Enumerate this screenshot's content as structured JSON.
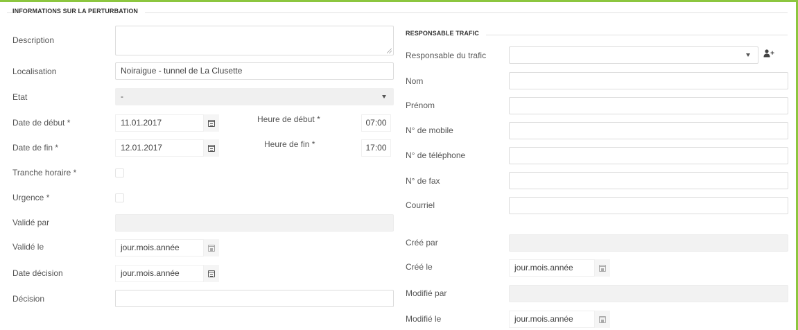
{
  "left_section": {
    "title": "INFORMATIONS SUR LA PERTURBATION",
    "description": {
      "label": "Description",
      "value": ""
    },
    "localisation": {
      "label": "Localisation",
      "value": "Noiraigue - tunnel de La Clusette"
    },
    "etat": {
      "label": "Etat",
      "value": "-"
    },
    "date_debut": {
      "label": "Date de début *",
      "value": "11.01.2017"
    },
    "heure_debut": {
      "label": "Heure de début *",
      "value": "07:00"
    },
    "date_fin": {
      "label": "Date de fin *",
      "value": "12.01.2017"
    },
    "heure_fin": {
      "label": "Heure de fin *",
      "value": "17:00"
    },
    "tranche_horaire": {
      "label": "Tranche horaire *",
      "checked": false
    },
    "urgence": {
      "label": "Urgence *",
      "checked": false
    },
    "valide_par": {
      "label": "Validé par",
      "value": ""
    },
    "valide_le": {
      "label": "Validé le",
      "placeholder": "jour.mois.année"
    },
    "date_decision": {
      "label": "Date décision",
      "value": "jour.mois.année"
    },
    "decision": {
      "label": "Décision",
      "value": ""
    }
  },
  "right_section": {
    "title": "RESPONSABLE TRAFIC",
    "responsable": {
      "label": "Responsable du trafic",
      "value": ""
    },
    "nom": {
      "label": "Nom",
      "value": ""
    },
    "prenom": {
      "label": "Prénom",
      "value": ""
    },
    "mobile": {
      "label": "N° de mobile",
      "value": ""
    },
    "telephone": {
      "label": "N° de téléphone",
      "value": ""
    },
    "fax": {
      "label": "N° de fax",
      "value": ""
    },
    "courriel": {
      "label": "Courriel",
      "value": ""
    },
    "cree_par": {
      "label": "Créé par",
      "value": ""
    },
    "cree_le": {
      "label": "Créé le",
      "placeholder": "jour.mois.année"
    },
    "modifie_par": {
      "label": "Modifié par",
      "value": ""
    },
    "modifie_le": {
      "label": "Modifié le",
      "placeholder": "jour.mois.année"
    }
  },
  "icons": {
    "calendar": "calendar-icon",
    "dropdown": "chevron-down-icon",
    "add_user": "add-user-icon"
  },
  "colors": {
    "accent": "#8cc63f",
    "disabled_field": "#f2f2f2",
    "border": "#dcdcdc"
  }
}
